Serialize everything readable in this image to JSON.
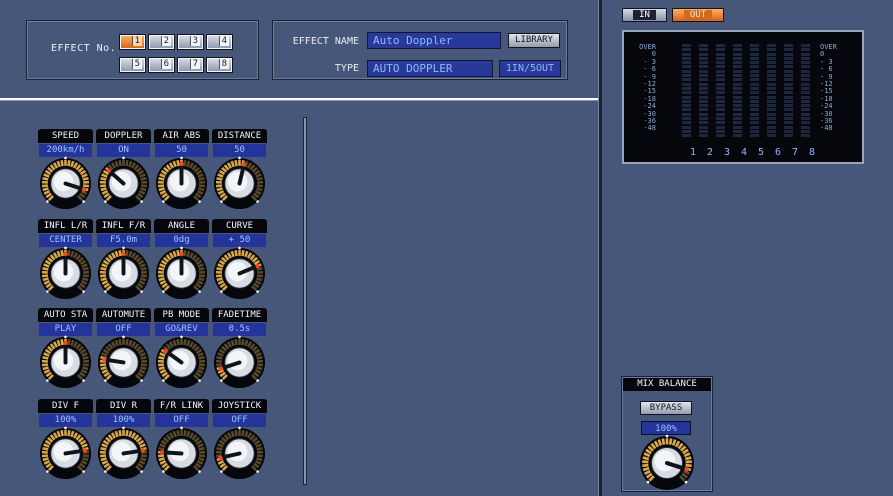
{
  "effect_no": {
    "label": "EFFECT No.",
    "buttons": [
      {
        "label": "1",
        "active": true
      },
      {
        "label": "2",
        "active": false
      },
      {
        "label": "3",
        "active": false
      },
      {
        "label": "4",
        "active": false
      },
      {
        "label": "5",
        "active": false
      },
      {
        "label": "6",
        "active": false
      },
      {
        "label": "7",
        "active": false
      },
      {
        "label": "8",
        "active": false
      }
    ]
  },
  "effect": {
    "name_label": "EFFECT NAME",
    "name_value": "Auto Doppler",
    "library_label": "LIBRARY",
    "type_label": "TYPE",
    "type_value": "AUTO DOPPLER",
    "io": "1IN/5OUT"
  },
  "params": [
    {
      "title": "SPEED",
      "value": "200km/h",
      "level": 0.9
    },
    {
      "title": "DOPPLER",
      "value": "ON",
      "level": 0.32
    },
    {
      "title": "AIR ABS",
      "value": "50",
      "level": 0.5
    },
    {
      "title": "DISTANCE",
      "value": "50",
      "level": 0.55
    },
    {
      "title": "INFL L/R",
      "value": "CENTER",
      "level": 0.5
    },
    {
      "title": "INFL F/R",
      "value": "F5.0m",
      "level": 0.5
    },
    {
      "title": "ANGLE",
      "value": "0dg",
      "level": 0.5
    },
    {
      "title": "CURVE",
      "value": "+ 50",
      "level": 0.75
    },
    {
      "title": "AUTO STA",
      "value": "PLAY",
      "level": 0.5
    },
    {
      "title": "AUTOMUTE",
      "value": "OFF",
      "level": 0.2
    },
    {
      "title": "PB MODE",
      "value": "GO&REV",
      "level": 0.3
    },
    {
      "title": "FADETIME",
      "value": "0.5s",
      "level": 0.1
    },
    {
      "title": "DIV F",
      "value": "100%",
      "level": 0.8
    },
    {
      "title": "DIV R",
      "value": "100%",
      "level": 0.8
    },
    {
      "title": "F/R LINK",
      "value": "OFF",
      "level": 0.18
    },
    {
      "title": "JOYSTICK",
      "value": "OFF",
      "level": 0.12
    }
  ],
  "io_tabs": {
    "in": "IN",
    "out": "OUT"
  },
  "meter": {
    "scale": [
      "OVER",
      "0",
      "- 3",
      "- 6",
      "- 9",
      "-12",
      "-15",
      "-18",
      "-24",
      "-30",
      "-36",
      "-48"
    ],
    "channels": [
      "1",
      "2",
      "3",
      "4",
      "5",
      "6",
      "7",
      "8"
    ]
  },
  "mix": {
    "title": "MIX BALANCE",
    "bypass_label": "BYPASS",
    "value": "100%",
    "level": 0.9
  },
  "colors": {
    "background": "#46577a",
    "accent_orange": "#e8761f",
    "value_field": "#24349a"
  }
}
